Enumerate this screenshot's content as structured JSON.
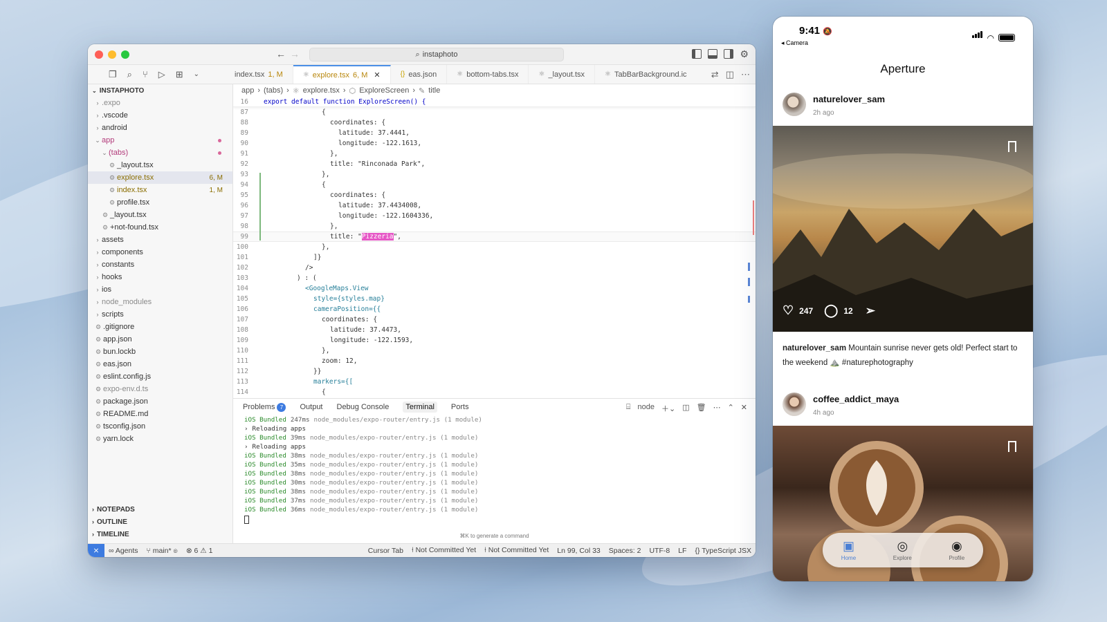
{
  "editor": {
    "search_text": "instaphoto",
    "tabs": [
      {
        "label": "index.tsx",
        "badge": "1, M"
      },
      {
        "label": "explore.tsx",
        "badge": "6, M"
      },
      {
        "label": "eas.json",
        "badge": ""
      },
      {
        "label": "bottom-tabs.tsx",
        "badge": ""
      },
      {
        "label": "_layout.tsx",
        "badge": ""
      },
      {
        "label": "TabBarBackground.ic",
        "badge": ""
      }
    ],
    "sidebar": {
      "title": "INSTAPHOTO",
      "items": [
        {
          "label": ".expo",
          "type": "folder",
          "depth": 0
        },
        {
          "label": ".vscode",
          "type": "folder",
          "depth": 0
        },
        {
          "label": "android",
          "type": "folder",
          "depth": 0
        },
        {
          "label": "app",
          "type": "folder-open",
          "depth": 0
        },
        {
          "label": "(tabs)",
          "type": "folder-open",
          "depth": 1
        },
        {
          "label": "_layout.tsx",
          "type": "file",
          "depth": 2
        },
        {
          "label": "explore.tsx",
          "type": "file",
          "depth": 2,
          "badge": "6, M"
        },
        {
          "label": "index.tsx",
          "type": "file",
          "depth": 2,
          "badge": "1, M"
        },
        {
          "label": "profile.tsx",
          "type": "file",
          "depth": 2
        },
        {
          "label": "_layout.tsx",
          "type": "file",
          "depth": 1
        },
        {
          "label": "+not-found.tsx",
          "type": "file",
          "depth": 1
        },
        {
          "label": "assets",
          "type": "folder",
          "depth": 0
        },
        {
          "label": "components",
          "type": "folder",
          "depth": 0
        },
        {
          "label": "constants",
          "type": "folder",
          "depth": 0
        },
        {
          "label": "hooks",
          "type": "folder",
          "depth": 0
        },
        {
          "label": "ios",
          "type": "folder",
          "depth": 0
        },
        {
          "label": "node_modules",
          "type": "folder",
          "depth": 0
        },
        {
          "label": "scripts",
          "type": "folder",
          "depth": 0
        },
        {
          "label": ".gitignore",
          "type": "file",
          "depth": 0
        },
        {
          "label": "app.json",
          "type": "file",
          "depth": 0
        },
        {
          "label": "bun.lockb",
          "type": "file",
          "depth": 0
        },
        {
          "label": "eas.json",
          "type": "file",
          "depth": 0
        },
        {
          "label": "eslint.config.js",
          "type": "file",
          "depth": 0
        },
        {
          "label": "expo-env.d.ts",
          "type": "file",
          "depth": 0
        },
        {
          "label": "package.json",
          "type": "file",
          "depth": 0
        },
        {
          "label": "README.md",
          "type": "file",
          "depth": 0
        },
        {
          "label": "tsconfig.json",
          "type": "file",
          "depth": 0
        },
        {
          "label": "yarn.lock",
          "type": "file",
          "depth": 0
        }
      ],
      "bottom_sections": [
        "NOTEPADS",
        "OUTLINE",
        "TIMELINE"
      ]
    },
    "breadcrumb": [
      "app",
      "(tabs)",
      "explore.tsx",
      "ExploreScreen",
      "title"
    ],
    "sticky_line": {
      "num": "16",
      "text": "export default function ExploreScreen() {"
    },
    "code_lines": [
      {
        "num": "87",
        "text": "{"
      },
      {
        "num": "88",
        "text": "coordinates: {"
      },
      {
        "num": "89",
        "text": "latitude: 37.4441,"
      },
      {
        "num": "90",
        "text": "longitude: -122.1613,"
      },
      {
        "num": "91",
        "text": "},"
      },
      {
        "num": "92",
        "text": "title: \"Rinconada Park\","
      },
      {
        "num": "93",
        "text": "},"
      },
      {
        "num": "94",
        "text": "{"
      },
      {
        "num": "95",
        "text": "coordinates: {"
      },
      {
        "num": "96",
        "text": "latitude: 37.4434008,"
      },
      {
        "num": "97",
        "text": "longitude: -122.1604336,"
      },
      {
        "num": "98",
        "text": "},"
      },
      {
        "num": "99",
        "text": "title: \"Pizzeria\","
      },
      {
        "num": "100",
        "text": "},"
      },
      {
        "num": "101",
        "text": "]}"
      },
      {
        "num": "102",
        "text": "/>"
      },
      {
        "num": "103",
        "text": ") : ("
      },
      {
        "num": "104",
        "text": "<GoogleMaps.View"
      },
      {
        "num": "105",
        "text": "style={styles.map}"
      },
      {
        "num": "106",
        "text": "cameraPosition={{"
      },
      {
        "num": "107",
        "text": "coordinates: {"
      },
      {
        "num": "108",
        "text": "latitude: 37.4473,"
      },
      {
        "num": "109",
        "text": "longitude: -122.1593,"
      },
      {
        "num": "110",
        "text": "},"
      },
      {
        "num": "111",
        "text": "zoom: 12,"
      },
      {
        "num": "112",
        "text": "}}"
      },
      {
        "num": "113",
        "text": "markers={["
      },
      {
        "num": "114",
        "text": "{"
      }
    ],
    "panel_tabs": [
      "Problems",
      "Output",
      "Debug Console",
      "Terminal",
      "Ports"
    ],
    "problems_count": "7",
    "terminal_shell": "node",
    "terminal_lines": [
      {
        "prefix": "iOS Bundled",
        "ms": "247ms",
        "rest": "node_modules/expo-router/entry.js (1 module)"
      },
      {
        "prefix": "›",
        "ms": "",
        "rest": "Reloading apps"
      },
      {
        "prefix": "iOS Bundled",
        "ms": "39ms",
        "rest": "node_modules/expo-router/entry.js (1 module)"
      },
      {
        "prefix": "›",
        "ms": "",
        "rest": "Reloading apps"
      },
      {
        "prefix": "iOS Bundled",
        "ms": "38ms",
        "rest": "node_modules/expo-router/entry.js (1 module)"
      },
      {
        "prefix": "iOS Bundled",
        "ms": "35ms",
        "rest": "node_modules/expo-router/entry.js (1 module)"
      },
      {
        "prefix": "iOS Bundled",
        "ms": "38ms",
        "rest": "node_modules/expo-router/entry.js (1 module)"
      },
      {
        "prefix": "iOS Bundled",
        "ms": "30ms",
        "rest": "node_modules/expo-router/entry.js (1 module)"
      },
      {
        "prefix": "iOS Bundled",
        "ms": "38ms",
        "rest": "node_modules/expo-router/entry.js (1 module)"
      },
      {
        "prefix": "iOS Bundled",
        "ms": "37ms",
        "rest": "node_modules/expo-router/entry.js (1 module)"
      },
      {
        "prefix": "iOS Bundled",
        "ms": "36ms",
        "rest": "node_modules/expo-router/entry.js (1 module)"
      }
    ],
    "terminal_hint": "⌘K to generate a command",
    "status": {
      "agents": "Agents",
      "branch": "main*",
      "errors": "6",
      "warnings": "1",
      "cursor_tab": "Cursor Tab",
      "commit1": "Not Committed Yet",
      "commit2": "Not Committed Yet",
      "position": "Ln 99, Col 33",
      "spaces": "Spaces: 2",
      "encoding": "UTF-8",
      "eol": "LF",
      "language": "TypeScript JSX"
    }
  },
  "phone": {
    "time": "9:41",
    "back_label": "◂ Camera",
    "app_title": "Aperture",
    "posts": [
      {
        "user": "naturelover_sam",
        "ago": "2h ago",
        "likes": "247",
        "comments": "12",
        "caption_user": "naturelover_sam",
        "caption": "Mountain sunrise never gets old! Perfect start to the weekend ⛰️ #naturephotography"
      },
      {
        "user": "coffee_addict_maya",
        "ago": "4h ago"
      }
    ],
    "tabs": [
      {
        "label": "Home",
        "icon": "home-icon",
        "active": true
      },
      {
        "label": "Explore",
        "icon": "compass-icon",
        "active": false
      },
      {
        "label": "Profile",
        "icon": "person-icon",
        "active": false
      }
    ]
  },
  "colors": {
    "accent": "#3d7be0",
    "highlight": "#e657c6",
    "git_added": "#7cb87c"
  }
}
